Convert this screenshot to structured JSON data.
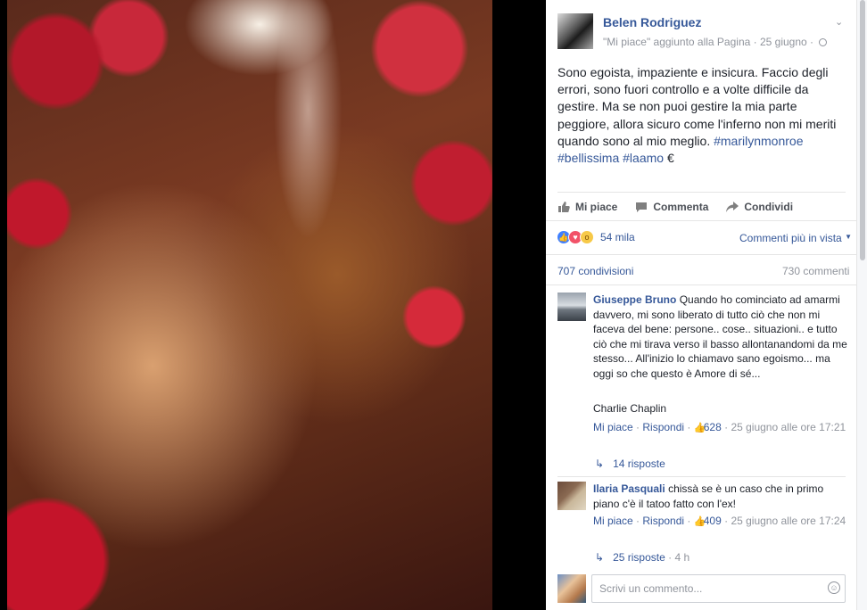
{
  "post": {
    "page_name": "Belen Rodriguez",
    "meta": "\"Mi piace\" aggiunto alla Pagina · 25 giugno ·",
    "text_main": "Sono egoista, impaziente e insicura. Faccio degli errori, sono fuori controllo e a volte difficile da gestire. Ma se non puoi gestire la mia parte peggiore, allora sicuro come l'inferno non mi meriti quando sono al mio meglio. ",
    "hashtags": [
      "#marilynmonroe",
      "#bellissima",
      "#laamo"
    ],
    "trailing_char": "€"
  },
  "actions": {
    "like": "Mi piace",
    "comment": "Commenta",
    "share": "Condividi"
  },
  "stats": {
    "reactions_count": "54 mila",
    "sort_label": "Commenti più in vista",
    "shares": "707 condivisioni",
    "comments": "730 commenti"
  },
  "comments": [
    {
      "author": "Giuseppe Bruno",
      "text": "Quando ho cominciato ad amarmi davvero, mi sono liberato di tutto ciò che non mi faceva del bene: persone.. cose.. situazioni.. e tutto ciò che mi tirava verso il basso allontanandomi da me stesso... All'inizio lo chiamavo sano egoismo... ma oggi so che questo è Amore di sé...",
      "signature": "Charlie Chaplin",
      "like": "Mi piace",
      "reply": "Rispondi",
      "likes": "628",
      "time": "25 giugno alle ore 17:21",
      "replies": "14 risposte",
      "replies_time": ""
    },
    {
      "author": "Ilaria Pasquali",
      "text": "chissà se è un caso che in primo piano c'è il tatoo fatto con l'ex!",
      "signature": "",
      "like": "Mi piace",
      "reply": "Rispondi",
      "likes": "409",
      "time": "25 giugno alle ore 17:24",
      "replies": "25 risposte",
      "replies_time": "4 h"
    }
  ],
  "composer": {
    "placeholder": "Scrivi un commento..."
  },
  "colors": {
    "link": "#365899",
    "muted": "#90949c",
    "like_blue": "#4080ff",
    "love_red": "#f25268",
    "wow_yellow": "#f7c948"
  }
}
